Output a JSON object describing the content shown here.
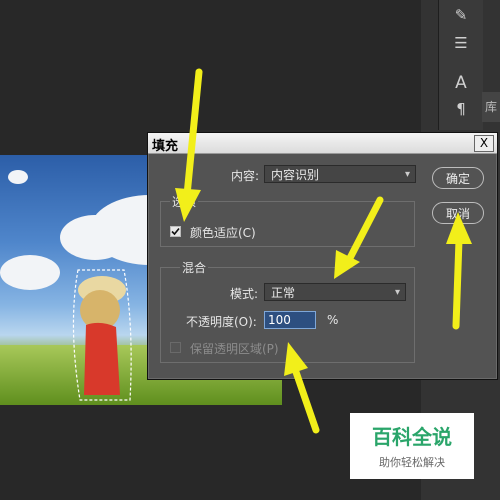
{
  "dialog": {
    "title": "填充",
    "close_symbol": "X",
    "content_label": "内容:",
    "content_value": "内容识别",
    "ok_label": "确定",
    "cancel_label": "取消",
    "options_group_label": "选项",
    "color_adapt_label": "颜色适应(C)",
    "color_adapt_checked": true,
    "blend_group_label": "混合",
    "mode_label": "模式:",
    "mode_value": "正常",
    "opacity_label": "不透明度(O):",
    "opacity_value": "100",
    "opacity_unit": "%",
    "preserve_transparency_label": "保留透明区域(P)",
    "preserve_transparency_checked": false
  },
  "side_panel": {
    "tab_label": "库",
    "tools": [
      "brush-settings-icon",
      "adjust-sliders-icon",
      "character-icon",
      "paragraph-icon"
    ]
  },
  "watermark": {
    "title": "百科全说",
    "subtitle": "助你轻松解决"
  },
  "colors": {
    "dialog_bg": "#535353",
    "app_bg": "#282828",
    "arrow": "#f2ef1a",
    "watermark_green": "#2aa56a"
  }
}
